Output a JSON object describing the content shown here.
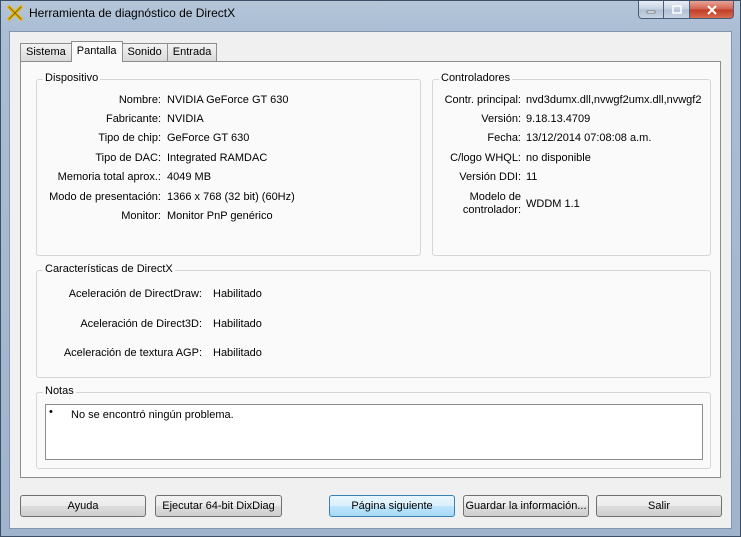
{
  "window": {
    "title": "Herramienta de diagnóstico de DirectX"
  },
  "tabs": [
    {
      "label": "Sistema"
    },
    {
      "label": "Pantalla"
    },
    {
      "label": "Sonido"
    },
    {
      "label": "Entrada"
    }
  ],
  "device": {
    "title": "Dispositivo",
    "rows": [
      {
        "label": "Nombre:",
        "value": "NVIDIA GeForce GT 630"
      },
      {
        "label": "Fabricante:",
        "value": "NVIDIA"
      },
      {
        "label": "Tipo de chip:",
        "value": "GeForce GT 630"
      },
      {
        "label": "Tipo de DAC:",
        "value": "Integrated RAMDAC"
      },
      {
        "label": "Memoria total aprox.:",
        "value": "4049 MB"
      },
      {
        "label": "Modo de presentación:",
        "value": "1366 x 768 (32 bit) (60Hz)"
      },
      {
        "label": "Monitor:",
        "value": "Monitor PnP genérico"
      }
    ]
  },
  "drivers": {
    "title": "Controladores",
    "rows": [
      {
        "label": "Contr. principal:",
        "value": "nvd3dumx.dll,nvwgf2umx.dll,nvwgf2"
      },
      {
        "label": "Versión:",
        "value": "9.18.13.4709"
      },
      {
        "label": "Fecha:",
        "value": "13/12/2014 07:08:08 a.m."
      },
      {
        "label": "C/logo WHQL:",
        "value": "no disponible"
      },
      {
        "label": "Versión DDI:",
        "value": "11"
      },
      {
        "label": "Modelo de",
        "label2": "controlador:",
        "value": "WDDM 1.1"
      }
    ]
  },
  "directx": {
    "title": "Características de DirectX",
    "rows": [
      {
        "label": "Aceleración de DirectDraw:",
        "value": "Habilitado"
      },
      {
        "label": "Aceleración de Direct3D:",
        "value": "Habilitado"
      },
      {
        "label": "Aceleración de textura AGP:",
        "value": "Habilitado"
      }
    ]
  },
  "notes": {
    "title": "Notas",
    "bullet": "•",
    "items": [
      "No se encontró ningún problema."
    ]
  },
  "buttons": {
    "help": "Ayuda",
    "run64": "Ejecutar 64-bit DixDiag",
    "next": "Página siguiente",
    "save": "Guardar la información...",
    "exit": "Salir"
  }
}
